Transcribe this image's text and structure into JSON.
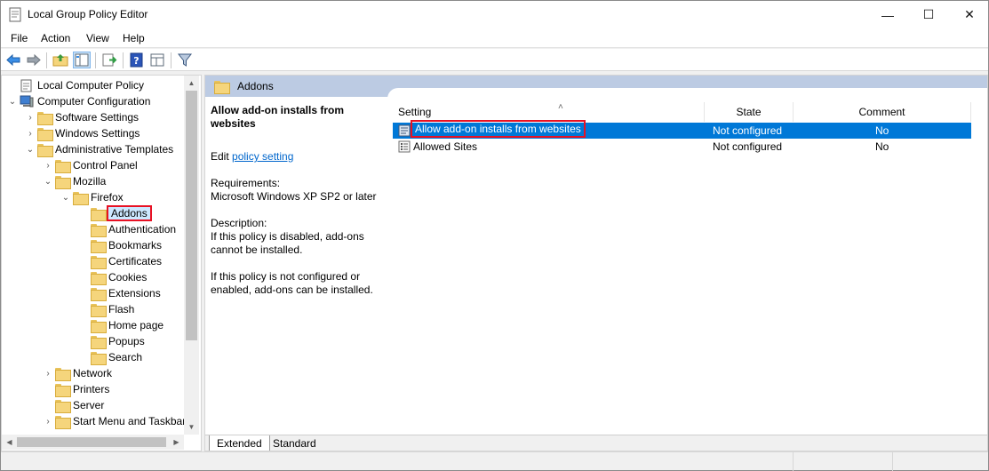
{
  "window": {
    "title": "Local Group Policy Editor"
  },
  "window_controls": {
    "minimize": "—",
    "maximize": "☐",
    "close": "✕"
  },
  "menu": [
    "File",
    "Action",
    "View",
    "Help"
  ],
  "tree": {
    "items": [
      {
        "label": "Local Computer Policy",
        "chevron": "",
        "icon": "policy-doc-icon"
      },
      {
        "label": "Computer Configuration",
        "chevron": "⌄",
        "icon": "computer-icon"
      },
      {
        "label": "Software Settings",
        "chevron": "›",
        "icon": "folder-icon"
      },
      {
        "label": "Windows Settings",
        "chevron": "›",
        "icon": "folder-icon"
      },
      {
        "label": "Administrative Templates",
        "chevron": "⌄",
        "icon": "folder-icon"
      },
      {
        "label": "Control Panel",
        "chevron": "›",
        "icon": "folder-icon"
      },
      {
        "label": "Mozilla",
        "chevron": "⌄",
        "icon": "folder-icon"
      },
      {
        "label": "Firefox",
        "chevron": "⌄",
        "icon": "folder-icon"
      },
      {
        "label": "Addons",
        "chevron": "",
        "icon": "folder-icon",
        "selected": true
      },
      {
        "label": "Authentication",
        "chevron": "",
        "icon": "folder-icon"
      },
      {
        "label": "Bookmarks",
        "chevron": "",
        "icon": "folder-icon"
      },
      {
        "label": "Certificates",
        "chevron": "",
        "icon": "folder-icon"
      },
      {
        "label": "Cookies",
        "chevron": "",
        "icon": "folder-icon"
      },
      {
        "label": "Extensions",
        "chevron": "",
        "icon": "folder-icon"
      },
      {
        "label": "Flash",
        "chevron": "",
        "icon": "folder-icon"
      },
      {
        "label": "Home page",
        "chevron": "",
        "icon": "folder-icon"
      },
      {
        "label": "Popups",
        "chevron": "",
        "icon": "folder-icon"
      },
      {
        "label": "Search",
        "chevron": "",
        "icon": "folder-icon"
      },
      {
        "label": "Network",
        "chevron": "›",
        "icon": "folder-icon"
      },
      {
        "label": "Printers",
        "chevron": "",
        "icon": "folder-icon"
      },
      {
        "label": "Server",
        "chevron": "",
        "icon": "folder-icon"
      },
      {
        "label": "Start Menu and Taskbar",
        "chevron": "›",
        "icon": "folder-icon"
      }
    ]
  },
  "right": {
    "header_title": "Addons",
    "description": {
      "title": "Allow add-on installs from websites",
      "edit_prefix": "Edit",
      "edit_link": "policy setting",
      "requirements_label": "Requirements:",
      "requirements": "Microsoft Windows XP SP2 or later",
      "description_label": "Description:",
      "line1": "If this policy is disabled, add-ons cannot be installed.",
      "line2": "If this policy is not configured or enabled, add-ons can be installed."
    },
    "columns": {
      "setting": "Setting",
      "state": "State",
      "comment": "Comment"
    },
    "rows": [
      {
        "setting": "Allow add-on installs from websites",
        "state": "Not configured",
        "comment": "No",
        "selected": true
      },
      {
        "setting": "Allowed Sites",
        "state": "Not configured",
        "comment": "No"
      }
    ],
    "tabs": [
      "Extended",
      "Standard"
    ]
  },
  "colors": {
    "selection": "#0078d7",
    "header_band": "#bccbe3",
    "highlight_box": "#e81123",
    "link": "#0066cc"
  }
}
